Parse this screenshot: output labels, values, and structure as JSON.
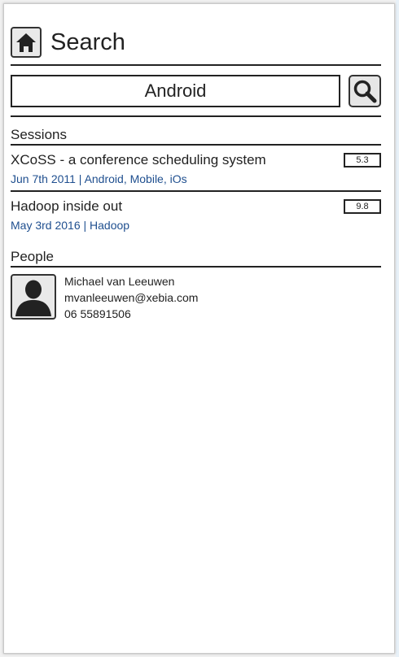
{
  "header": {
    "title": "Search",
    "home_icon": "home-icon"
  },
  "search": {
    "value": "Android",
    "button_icon": "search-icon"
  },
  "sessions": {
    "title": "Sessions",
    "items": [
      {
        "title": "XCoSS - a conference scheduling system",
        "meta": "Jun 7th 2011 | Android, Mobile, iOs",
        "score": "5.3"
      },
      {
        "title": "Hadoop inside out",
        "meta": "May 3rd 2016 | Hadoop",
        "score": "9.8"
      }
    ]
  },
  "people": {
    "title": "People",
    "items": [
      {
        "name": "Michael van Leeuwen",
        "email": "mvanleeuwen@xebia.com",
        "phone": "06 55891506",
        "avatar_icon": "person-avatar-icon"
      }
    ]
  },
  "colors": {
    "link_blue": "#1f4f8f",
    "line": "#222222"
  }
}
